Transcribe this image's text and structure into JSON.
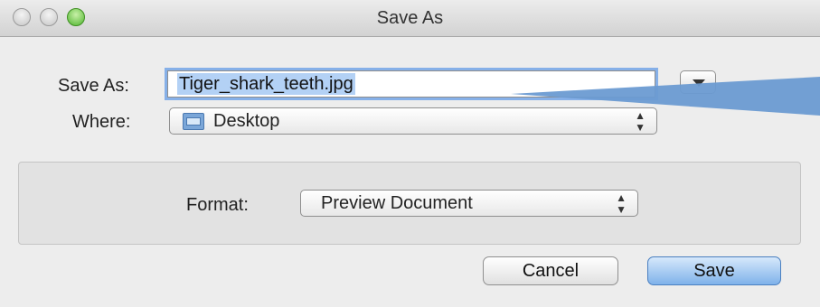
{
  "window": {
    "title": "Save As"
  },
  "save_as": {
    "label": "Save As:",
    "value": "Tiger_shark_teeth.jpg"
  },
  "where": {
    "label": "Where:",
    "value": "Desktop",
    "icon": "folder-icon"
  },
  "format": {
    "label": "Format:",
    "value": "Preview Document"
  },
  "buttons": {
    "cancel": "Cancel",
    "save": "Save"
  },
  "colors": {
    "accent": "#6c9bd2",
    "selection": "#b3d1f5",
    "focus_ring": "#86b0e8",
    "zoom_button": "#4fb52e"
  }
}
